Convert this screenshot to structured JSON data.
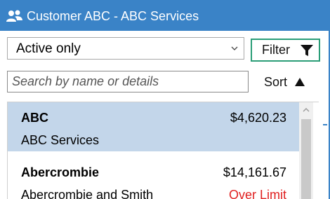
{
  "window": {
    "title": "Customer ABC - ABC Services",
    "icon": "people-icon",
    "titlebar_color": "#3a83c7"
  },
  "filter": {
    "selected": "Active only",
    "button_label": "Filter",
    "button_icon": "funnel-icon",
    "highlight_color": "#2a9d77"
  },
  "search": {
    "placeholder": "Search by name or details",
    "value": ""
  },
  "sort": {
    "label": "Sort",
    "direction_icon": "triangle-up-icon"
  },
  "customers": [
    {
      "name": "ABC",
      "amount": "$4,620.23",
      "detail": "ABC Services",
      "status": "",
      "selected": true
    },
    {
      "name": "Abercrombie",
      "amount": "$14,161.67",
      "detail": "Abercrombie and Smith",
      "status": "Over Limit",
      "status_color": "#e02020",
      "selected": false
    }
  ]
}
